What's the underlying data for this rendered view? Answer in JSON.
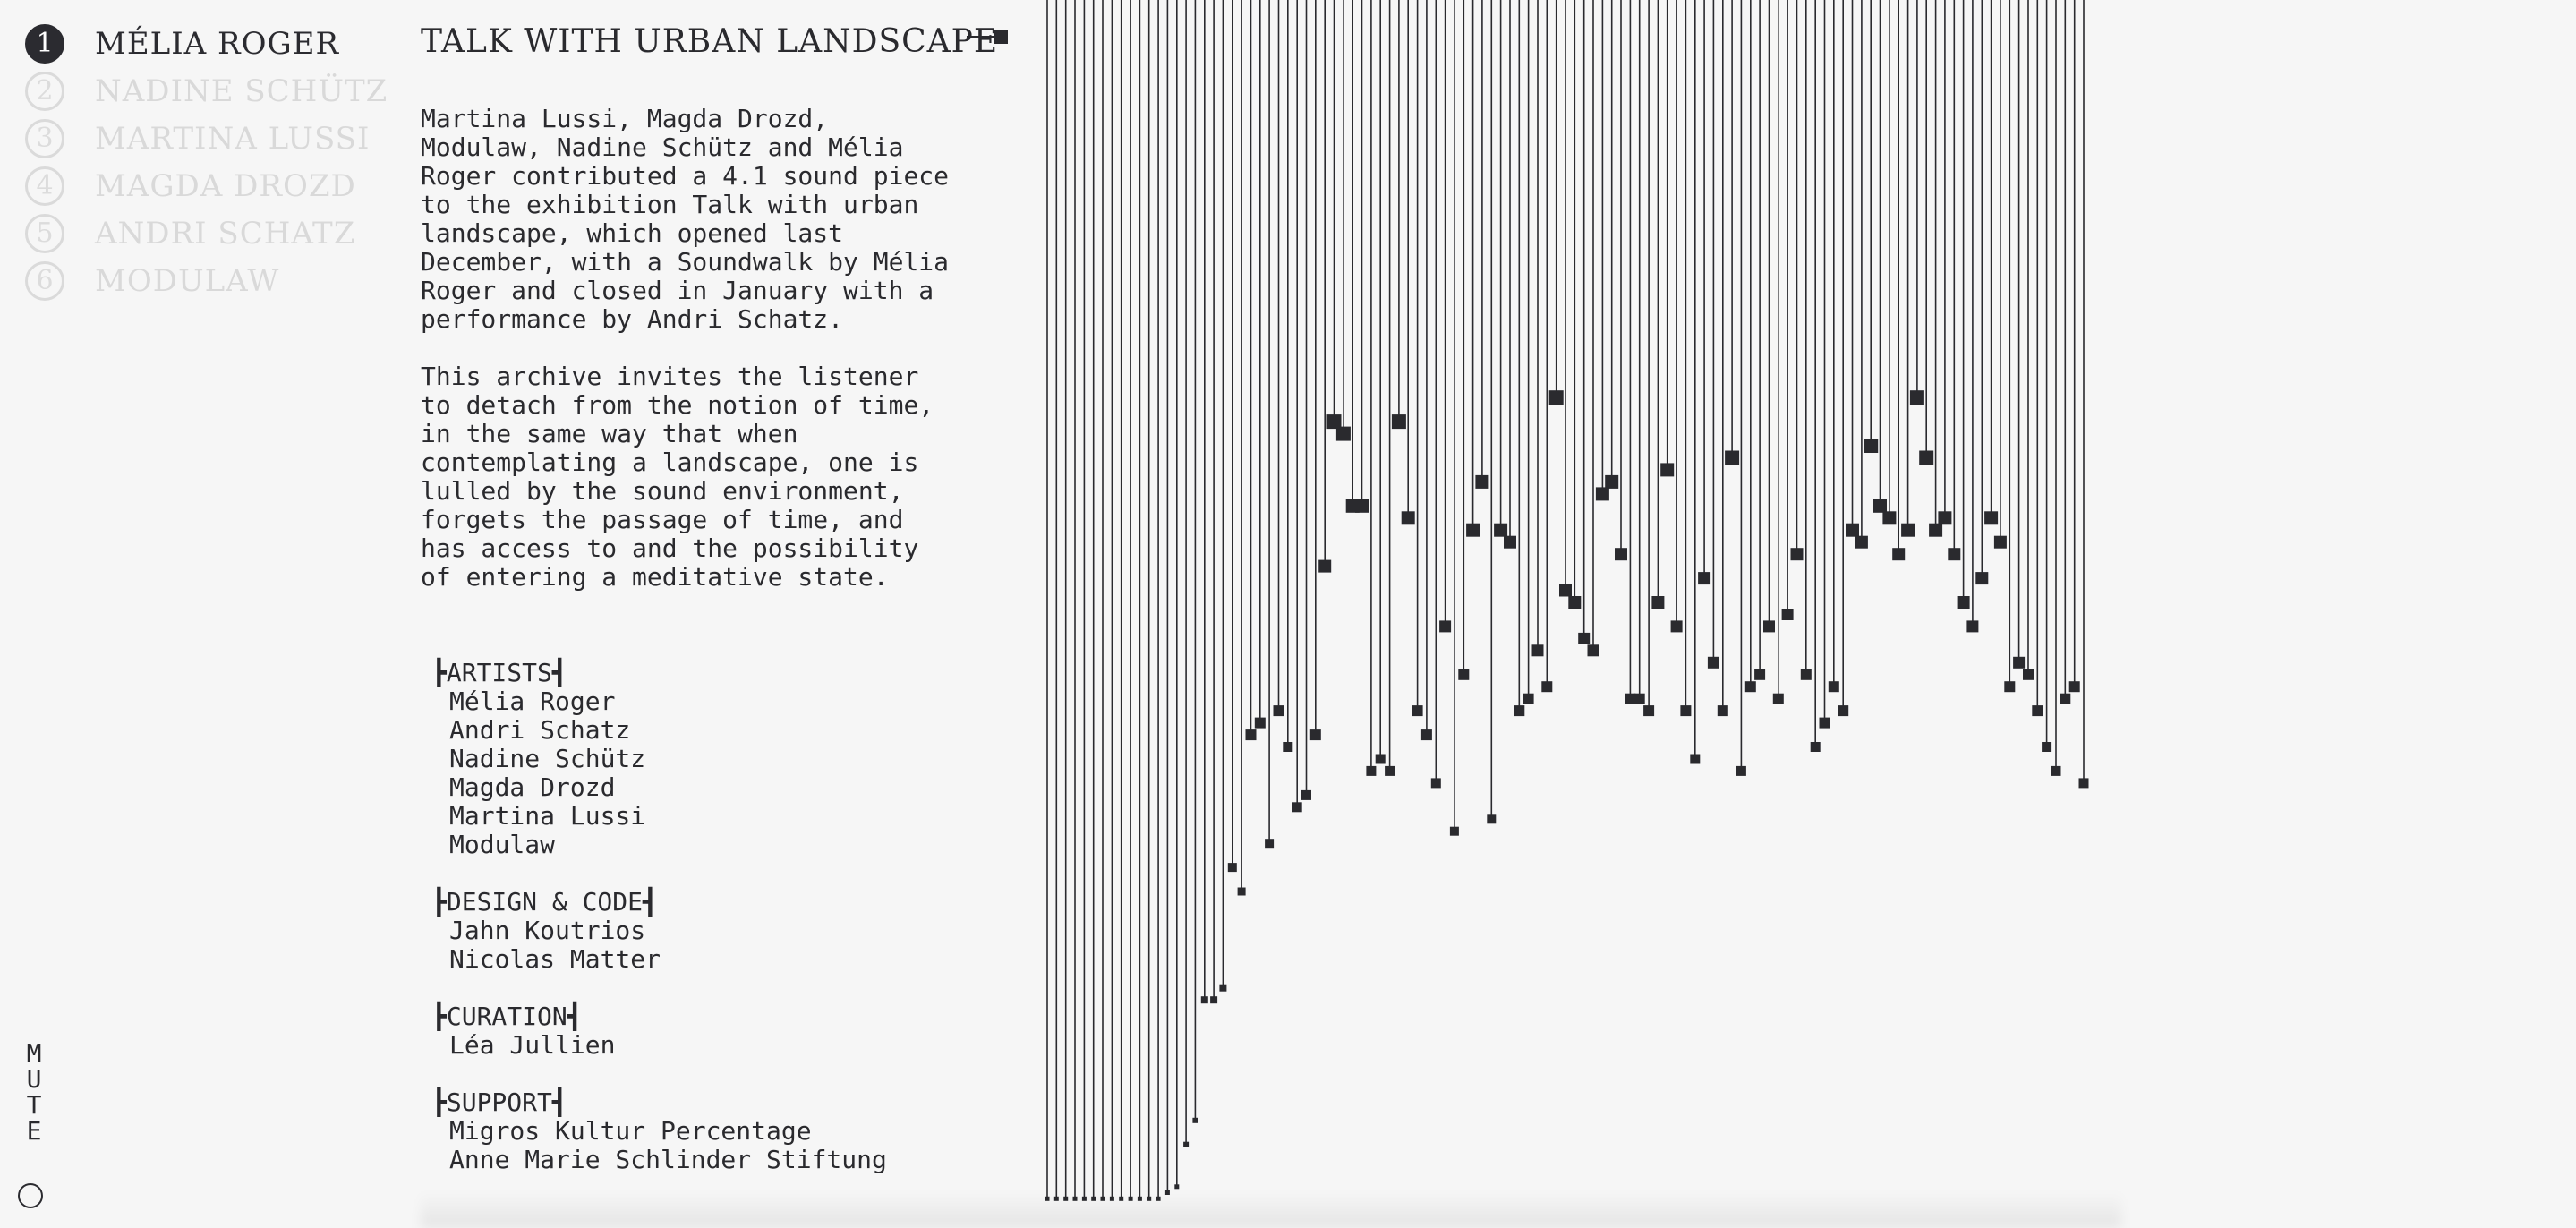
{
  "nav": {
    "items": [
      {
        "num": "1",
        "label": "MÉLIA ROGER",
        "active": true
      },
      {
        "num": "2",
        "label": "NADINE SCHÜTZ",
        "active": false
      },
      {
        "num": "3",
        "label": "MARTINA LUSSI",
        "active": false
      },
      {
        "num": "4",
        "label": "MAGDA DROZD",
        "active": false
      },
      {
        "num": "5",
        "label": "ANDRI SCHATZ",
        "active": false
      },
      {
        "num": "6",
        "label": "MODULAW",
        "active": false
      }
    ]
  },
  "content": {
    "title": "TALK WITH URBAN LANDSCAPE",
    "paragraph1": "Martina Lussi, Magda Drozd,\nModulaw, Nadine Schütz and Mélia\nRoger contributed a 4.1 sound piece\nto the exhibition Talk with urban\nlandscape, which opened last\nDecember, with a Soundwalk by Mélia\nRoger and closed in January with a\nperformance by Andri Schatz.",
    "paragraph2": "This archive invites the listener\nto detach from the notion of time,\nin the same way that when\ncontemplating a landscape, one is\nlulled by the sound environment,\nforgets the passage of time, and\nhas access to and the possibility\nof entering a meditative state."
  },
  "credits": [
    {
      "heading": "┣ARTISTS┫",
      "names": [
        "Mélia Roger",
        "Andri Schatz",
        "Nadine Schütz",
        "Magda Drozd",
        "Martina Lussi",
        "Modulaw"
      ]
    },
    {
      "heading": "┣DESIGN & CODE┫",
      "names": [
        "Jahn Koutrios",
        "Nicolas Matter"
      ]
    },
    {
      "heading": "┣CURATION┫",
      "names": [
        "Léa Jullien"
      ]
    },
    {
      "heading": "┣SUPPORT┫",
      "names": [
        "Migros Kultur Percentage",
        "Anne Marie Schlinder Stiftung"
      ]
    }
  ],
  "mute": {
    "label": "MUTE"
  },
  "colors": {
    "ink": "#2a2a2e",
    "inactive": "#d9d9d9",
    "background": "#f6f6f6"
  },
  "visualization": {
    "description_icon": "sound-level-bars",
    "levels": [
      0.995,
      0.995,
      0.995,
      0.995,
      0.995,
      0.995,
      0.995,
      0.995,
      0.995,
      0.995,
      0.995,
      0.995,
      0.995,
      0.99,
      0.985,
      0.95,
      0.93,
      0.83,
      0.83,
      0.82,
      0.72,
      0.74,
      0.61,
      0.6,
      0.7,
      0.59,
      0.62,
      0.67,
      0.66,
      0.61,
      0.47,
      0.35,
      0.36,
      0.42,
      0.42,
      0.64,
      0.63,
      0.64,
      0.35,
      0.43,
      0.59,
      0.61,
      0.65,
      0.52,
      0.69,
      0.56,
      0.44,
      0.4,
      0.68,
      0.44,
      0.45,
      0.59,
      0.58,
      0.54,
      0.57,
      0.33,
      0.49,
      0.5,
      0.53,
      0.54,
      0.41,
      0.4,
      0.46,
      0.58,
      0.58,
      0.59,
      0.5,
      0.39,
      0.52,
      0.59,
      0.63,
      0.48,
      0.55,
      0.59,
      0.38,
      0.64,
      0.57,
      0.56,
      0.52,
      0.58,
      0.51,
      0.46,
      0.56,
      0.62,
      0.6,
      0.57,
      0.59,
      0.44,
      0.45,
      0.37,
      0.42,
      0.43,
      0.46,
      0.44,
      0.33,
      0.38,
      0.44,
      0.43,
      0.46,
      0.5,
      0.52,
      0.48,
      0.43,
      0.45,
      0.57,
      0.55,
      0.56,
      0.59,
      0.62,
      0.64,
      0.58,
      0.57,
      0.65
    ]
  }
}
